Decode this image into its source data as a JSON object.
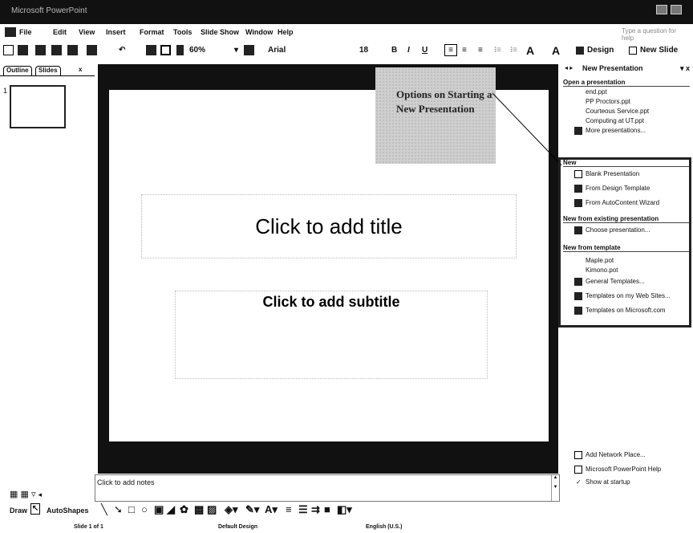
{
  "window": {
    "title": "Microsoft PowerPoint"
  },
  "menu": [
    "File",
    "Edit",
    "View",
    "Insert",
    "Format",
    "Tools",
    "Slide Show",
    "Window",
    "Help"
  ],
  "help_box": "Type a question for help",
  "toolbar": {
    "zoom": "60%",
    "font": "Arial",
    "size": "18",
    "bold": "B",
    "italic": "I",
    "underline": "U",
    "design": "Design",
    "new_slide": "New Slide"
  },
  "left_pane": {
    "tabs": [
      "Outline",
      "Slides"
    ],
    "close": "x",
    "slide_number": "1"
  },
  "slide": {
    "title_placeholder": "Click to add title",
    "subtitle_placeholder": "Click to add subtitle"
  },
  "callout": {
    "text": "Options on Starting a New Presentation"
  },
  "notes": {
    "placeholder": "Click to add notes"
  },
  "task_pane": {
    "title": "New Presentation",
    "open_section": "Open a presentation",
    "recent_files": [
      "end.ppt",
      "PP Proctors.ppt",
      "Courteous Service.ppt",
      "Computing at UT.ppt"
    ],
    "more": "More presentations...",
    "new_section": "New",
    "new_items": [
      "Blank Presentation",
      "From Design Template",
      "From AutoContent Wizard"
    ],
    "existing_section": "New from existing presentation",
    "choose": "Choose presentation...",
    "template_section": "New from template",
    "template_files": [
      "Maple.pot",
      "Kimono.pot"
    ],
    "template_links": [
      "General Templates...",
      "Templates on my Web Sites...",
      "Templates on Microsoft.com"
    ],
    "footer": [
      "Add Network Place...",
      "Microsoft PowerPoint Help",
      "Show at startup"
    ]
  },
  "drawing": {
    "draw": "Draw",
    "autoshapes": "AutoShapes"
  },
  "status": {
    "slide": "Slide 1 of 1",
    "design": "Default Design",
    "language": "English (U.S.)"
  }
}
